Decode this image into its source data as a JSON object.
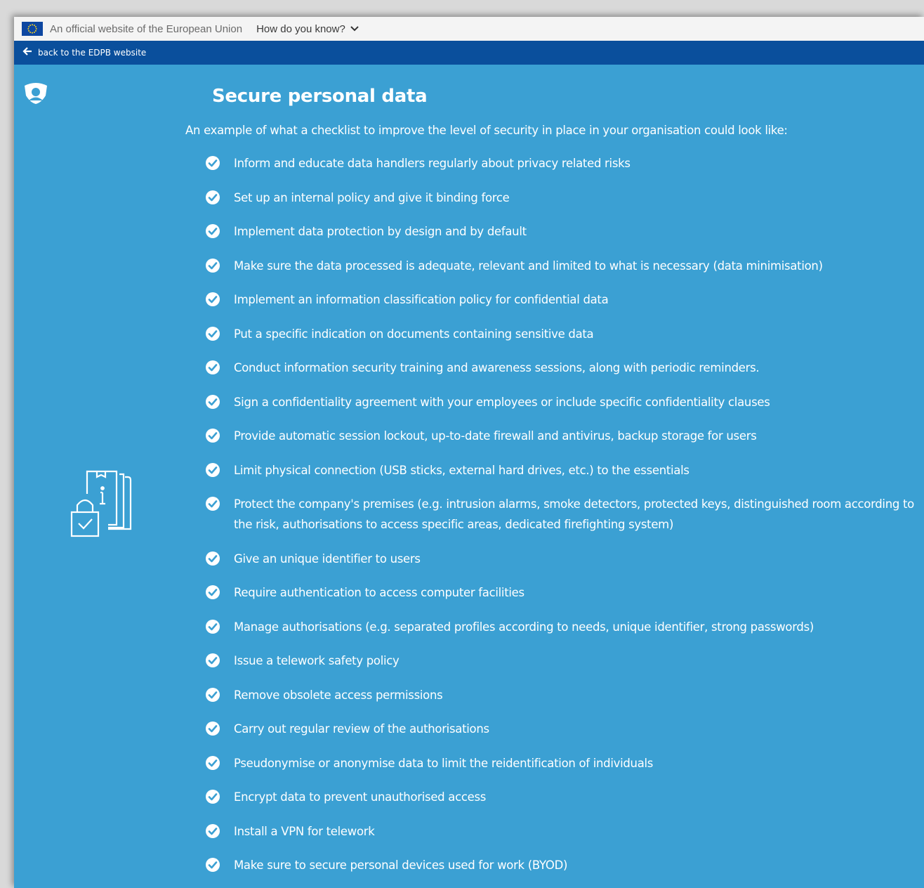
{
  "eu_banner": {
    "official_text": "An official website of the European Union",
    "how_know": "How do you know?"
  },
  "back_bar": {
    "back_label": "back to the EDPB website"
  },
  "main": {
    "title": "Secure personal data",
    "intro": "An example of what a checklist to improve the level of security in place in your organisation could look like:",
    "items": [
      "Inform and educate data handlers regularly about privacy related risks",
      "Set up an internal policy and give it binding force",
      "Implement data protection by design and by default",
      "Make sure the data processed is adequate, relevant and limited to what is necessary (data minimisation)",
      "Implement an information classification policy for confidential data",
      "Put a specific indication on documents containing sensitive data",
      "Conduct information security training and awareness sessions, along with periodic reminders.",
      "Sign a confidentiality agreement with your employees or include specific confidentiality clauses",
      "Provide automatic session lockout, up-to-date firewall and antivirus, backup storage for users",
      "Limit physical connection (USB sticks, external hard drives, etc.) to the essentials",
      "Protect the company's premises (e.g. intrusion alarms, smoke detectors, protected keys, distinguished room according to the risk, authorisations to access specific areas, dedicated firefighting system)",
      "Give an unique identifier to users",
      "Require authentication to access computer facilities",
      "Manage authorisations (e.g. separated profiles according to needs, unique identifier, strong passwords)",
      "Issue a telework safety policy",
      "Remove obsolete access permissions",
      "Carry out regular review of the authorisations",
      "Pseudonymise or anonymise data to limit the reidentification of individuals",
      "Encrypt data to prevent unauthorised access",
      "Install a VPN for telework",
      "Make sure to secure personal devices used for work (BYOD)"
    ]
  },
  "colors": {
    "page_bg": "#3ba0d3",
    "back_bar_bg": "#0a4f9c",
    "eu_bar_bg": "#f4f4f4",
    "eu_flag": "#0e47a1"
  },
  "icons": {
    "logo": "shield-logo-icon",
    "illustration": "document-lock-info-icon",
    "check": "check-circle-icon",
    "back": "arrow-left-icon",
    "chevron": "chevron-down-icon",
    "flag": "eu-flag-icon"
  }
}
